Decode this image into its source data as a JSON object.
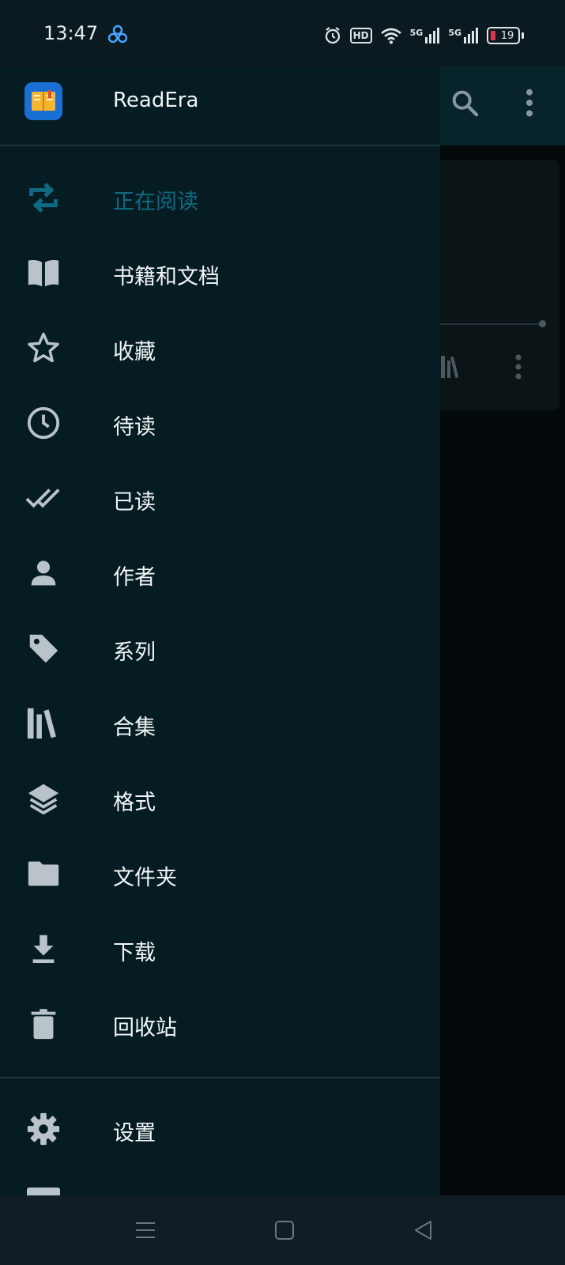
{
  "status_bar": {
    "time": "13:47",
    "hd_label": "HD",
    "network_1": "5G",
    "network_2": "5G",
    "battery_level": "19",
    "battery_color": "#e0344a"
  },
  "app": {
    "name": "ReadEra",
    "logo_color": "#1a6fd4",
    "accent": "#0f6a82"
  },
  "menu": {
    "items": [
      {
        "label": "正在阅读",
        "icon": "repeat-icon",
        "active": true
      },
      {
        "label": "书籍和文档",
        "icon": "book-open-icon"
      },
      {
        "label": "收藏",
        "icon": "star-outline-icon"
      },
      {
        "label": "待读",
        "icon": "clock-icon"
      },
      {
        "label": "已读",
        "icon": "double-check-icon"
      },
      {
        "label": "作者",
        "icon": "person-icon"
      },
      {
        "label": "系列",
        "icon": "tag-icon"
      },
      {
        "label": "合集",
        "icon": "bookshelf-icon"
      },
      {
        "label": "格式",
        "icon": "layers-icon"
      },
      {
        "label": "文件夹",
        "icon": "folder-icon"
      },
      {
        "label": "下载",
        "icon": "download-icon"
      },
      {
        "label": "回收站",
        "icon": "trash-icon"
      }
    ],
    "footer_items": [
      {
        "label": "设置",
        "icon": "gear-icon"
      }
    ]
  },
  "nav_bar": {
    "buttons": [
      "menu-icon",
      "home-square-icon",
      "back-triangle-icon"
    ]
  }
}
